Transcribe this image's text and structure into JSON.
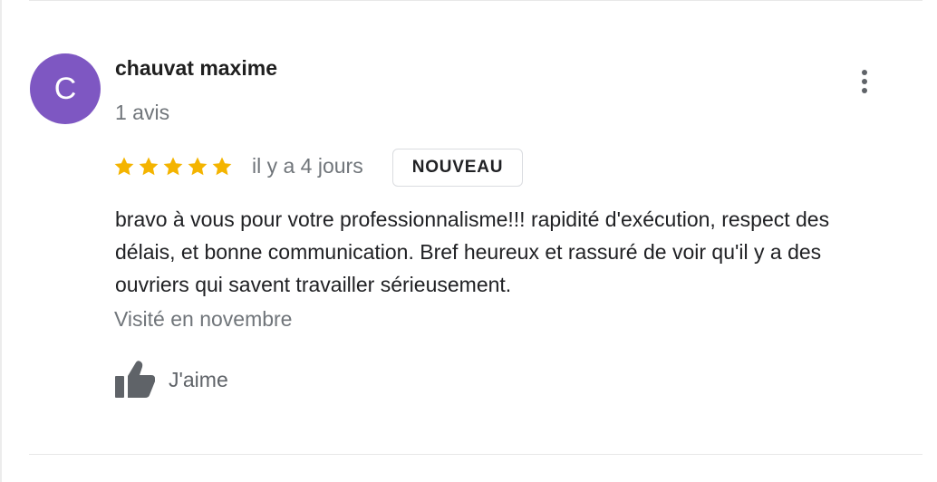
{
  "review": {
    "author": {
      "initial": "C",
      "name": "chauvat maxime",
      "review_count": "1 avis",
      "avatar_color": "#7e57c2"
    },
    "rating": 5,
    "max_rating": 5,
    "star_color": "#f4b400",
    "relative_date": "il y a 4 jours",
    "badge": "NOUVEAU",
    "text_lines": [
      "bravo à vous pour votre professionnalisme!!! rapidité d'exécution, respect des",
      "délais, et bonne communication. Bref heureux et rassuré de voir qu'il y a des",
      "ouvriers qui savent travailler sérieusement."
    ],
    "visit": "Visité en novembre",
    "like_label": "J'aime",
    "icons": {
      "more": "more-vertical-icon",
      "like": "thumb-up-icon",
      "star": "star-icon"
    }
  }
}
